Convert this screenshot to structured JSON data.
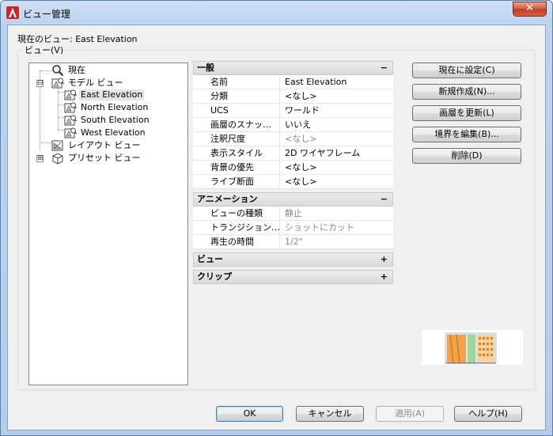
{
  "window": {
    "title": "ビュー管理",
    "close_label": "✕"
  },
  "current_view": {
    "text": "現在のビュー: East Elevation"
  },
  "views_group": {
    "label": "ビュー(V)"
  },
  "tree": {
    "current": "現在",
    "model_views": "モデル ビュー",
    "model_children": [
      "East Elevation",
      "North Elevation",
      "South Elevation",
      "West Elevation"
    ],
    "layout_views": "レイアウト ビュー",
    "preset_views": "プリセット ビュー",
    "expanded": "⊟",
    "collapsed": "⊞"
  },
  "properties": {
    "general": {
      "title": "一般",
      "toggle": "−",
      "rows": [
        {
          "key": "名前",
          "value": "East Elevation"
        },
        {
          "key": "分類",
          "value": "<なし>"
        },
        {
          "key": "UCS",
          "value": "ワールド"
        },
        {
          "key": "画層のスナッ…",
          "value": "いいえ"
        },
        {
          "key": "注釈尺度",
          "value": "<なし>"
        },
        {
          "key": "表示スタイル",
          "value": "2D ワイヤフレーム"
        },
        {
          "key": "背景の優先",
          "value": "<なし>"
        },
        {
          "key": "ライブ断面",
          "value": "<なし>"
        }
      ]
    },
    "animation": {
      "title": "アニメーション",
      "toggle": "−",
      "rows": [
        {
          "key": "ビューの種類",
          "value": "静止"
        },
        {
          "key": "トランジション…",
          "value": "ショットにカット"
        },
        {
          "key": "再生の時間",
          "value": "1/2\""
        }
      ]
    },
    "view": {
      "title": "ビュー",
      "toggle": "+"
    },
    "clip": {
      "title": "クリップ",
      "toggle": "+"
    }
  },
  "side_buttons": {
    "set_current": "現在に設定(C)",
    "new": "新規作成(N)...",
    "update_layers": "画層を更新(L)",
    "edit_boundaries": "境界を編集(B)...",
    "delete": "削除(D)"
  },
  "footer_buttons": {
    "ok": "OK",
    "cancel": "キャンセル",
    "apply": "適用(A)",
    "help": "ヘルプ(H)"
  },
  "colors": {
    "accent": "#3c7fb1",
    "title_bg": "#c6d9f0",
    "close": "#c94a31"
  }
}
